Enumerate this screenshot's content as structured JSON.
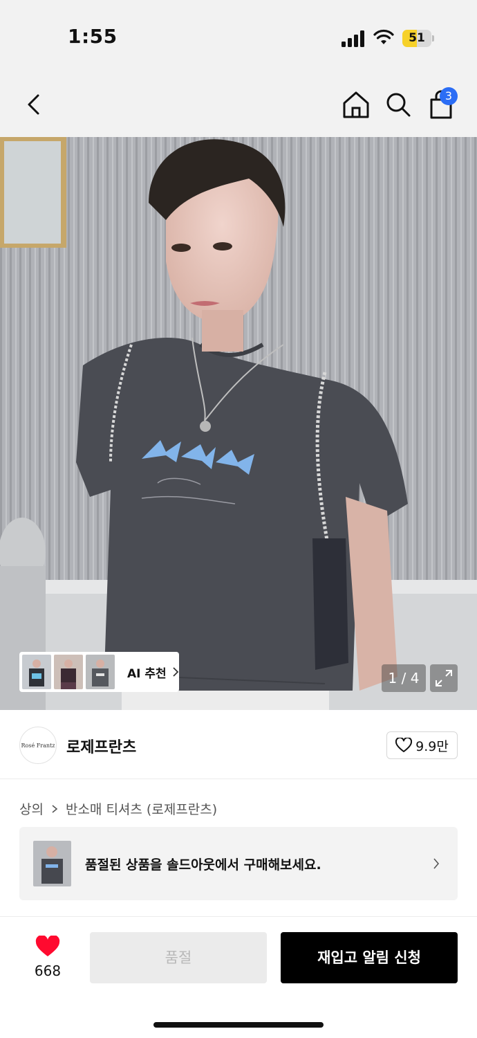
{
  "status_bar": {
    "time": "1:55",
    "battery_level": "51",
    "battery_fraction": 0.51,
    "icons": [
      "signal-icon",
      "wifi-icon",
      "battery-icon"
    ]
  },
  "nav": {
    "icons": [
      "back-icon",
      "home-icon",
      "search-icon",
      "cart-icon"
    ],
    "cart_count": "3",
    "badge_color": "#2b6df5"
  },
  "gallery": {
    "pager_text": "1 / 4",
    "ai_recommend_label": "AI 추천",
    "expand_icon": "expand-icon"
  },
  "brand": {
    "logo_text": "Rosé Frantz",
    "name": "로제프란츠",
    "likes": "9.9만"
  },
  "breadcrumb": {
    "level1": "상의",
    "level2": "반소매 티셔츠 (로제프란츠)"
  },
  "soldout_banner": {
    "message": "품절된 상품을 솔드아웃에서 구매해보세요."
  },
  "action_bar": {
    "wish_count": "668",
    "wish_color": "#ff0a2f",
    "soldout_label": "품절",
    "restock_label": "재입고 알림 신청"
  }
}
